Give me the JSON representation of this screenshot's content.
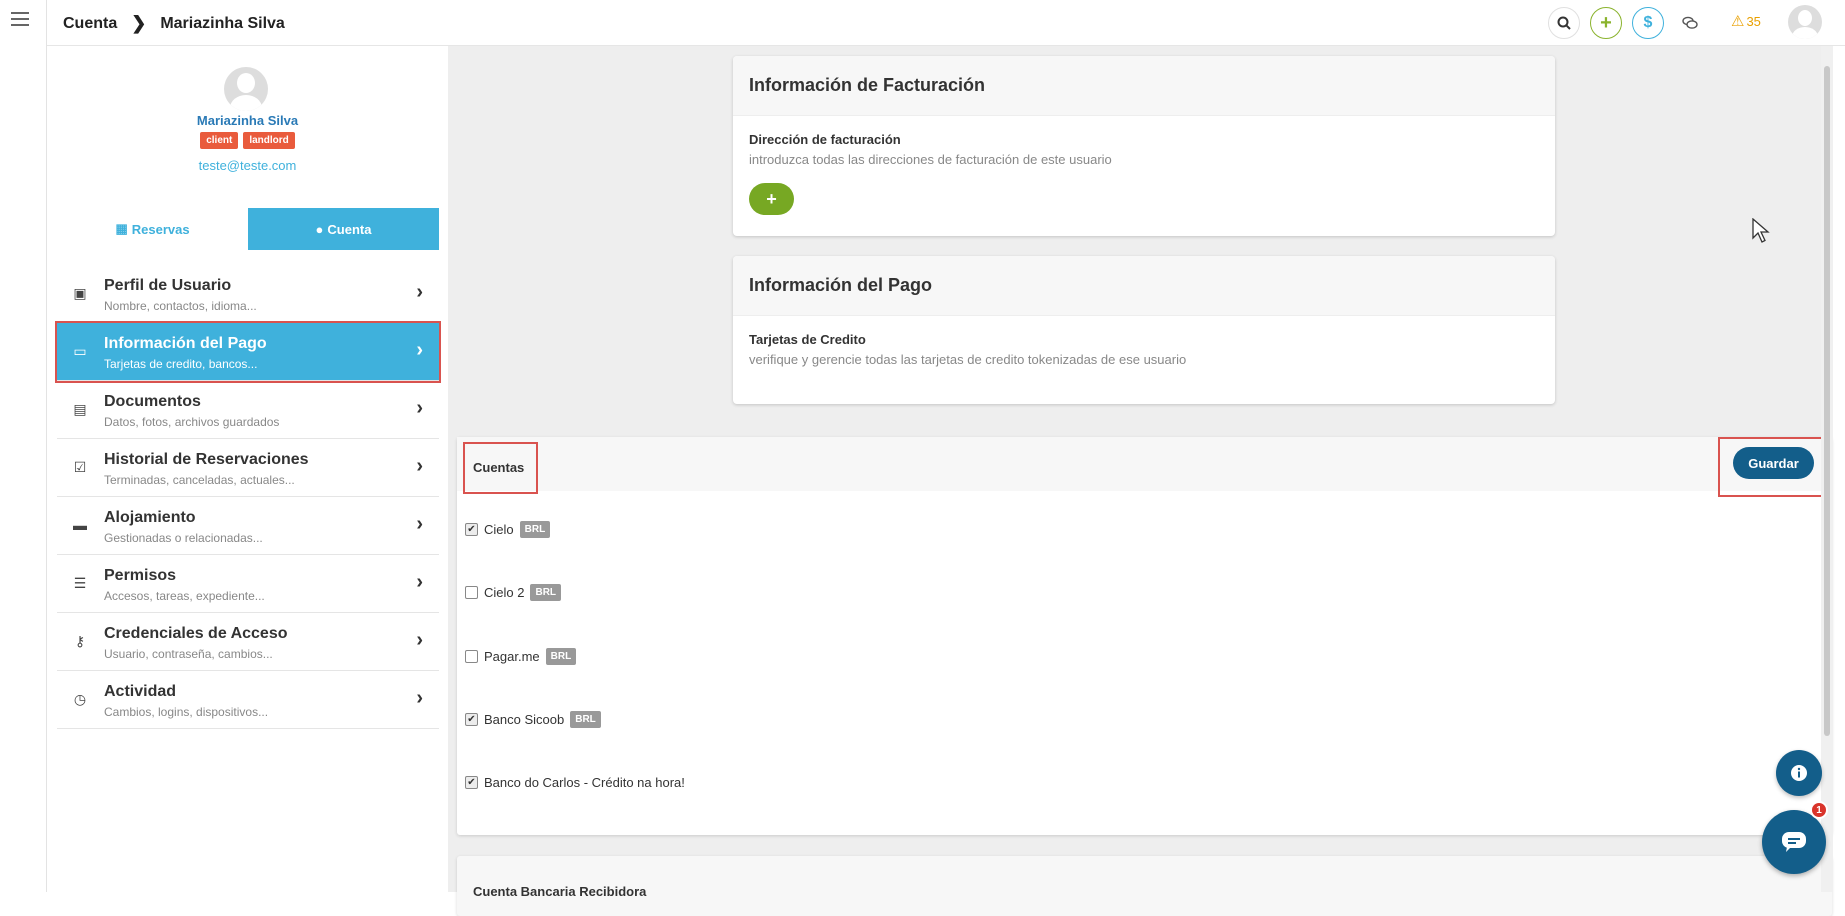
{
  "breadcrumb": {
    "root": "Cuenta",
    "current": "Mariazinha Silva"
  },
  "topbar": {
    "alerts_count": "35"
  },
  "profile": {
    "name": "Mariazinha Silva",
    "tags": [
      "client",
      "landlord"
    ],
    "email": "teste@teste.com"
  },
  "tabs": {
    "reservas": "Reservas",
    "cuenta": "Cuenta"
  },
  "nav": [
    {
      "title": "Perfil de Usuario",
      "subtitle": "Nombre, contactos, idioma..."
    },
    {
      "title": "Información del Pago",
      "subtitle": "Tarjetas de credito, bancos..."
    },
    {
      "title": "Documentos",
      "subtitle": "Datos, fotos, archivos guardados"
    },
    {
      "title": "Historial de Reservaciones",
      "subtitle": "Terminadas, canceladas, actuales..."
    },
    {
      "title": "Alojamiento",
      "subtitle": "Gestionadas o relacionadas..."
    },
    {
      "title": "Permisos",
      "subtitle": "Accesos, tareas, expediente..."
    },
    {
      "title": "Credenciales de Acceso",
      "subtitle": "Usuario, contraseña, cambios..."
    },
    {
      "title": "Actividad",
      "subtitle": "Cambios, logins, dispositivos..."
    }
  ],
  "billing": {
    "title": "Información de Facturación",
    "label": "Dirección de facturación",
    "description": "introduzca todas las direcciones de facturación de este usuario"
  },
  "payment": {
    "title": "Información del Pago",
    "label": "Tarjetas de Credito",
    "description": "verifique y gerencie todas las tarjetas de credito tokenizadas de ese usuario"
  },
  "accounts": {
    "title": "Cuentas",
    "save_label": "Guardar",
    "items": [
      {
        "name": "Cielo",
        "badge": "BRL",
        "checked": true
      },
      {
        "name": "Cielo 2",
        "badge": "BRL",
        "checked": false
      },
      {
        "name": "Pagar.me",
        "badge": "BRL",
        "checked": false
      },
      {
        "name": "Banco Sicoob",
        "badge": "BRL",
        "checked": true
      },
      {
        "name": "Banco do Carlos - Crédito na hora!",
        "badge": "",
        "checked": true
      }
    ]
  },
  "bank": {
    "title": "Cuenta Bancaria Recibidora"
  },
  "chat": {
    "unread": "1"
  }
}
